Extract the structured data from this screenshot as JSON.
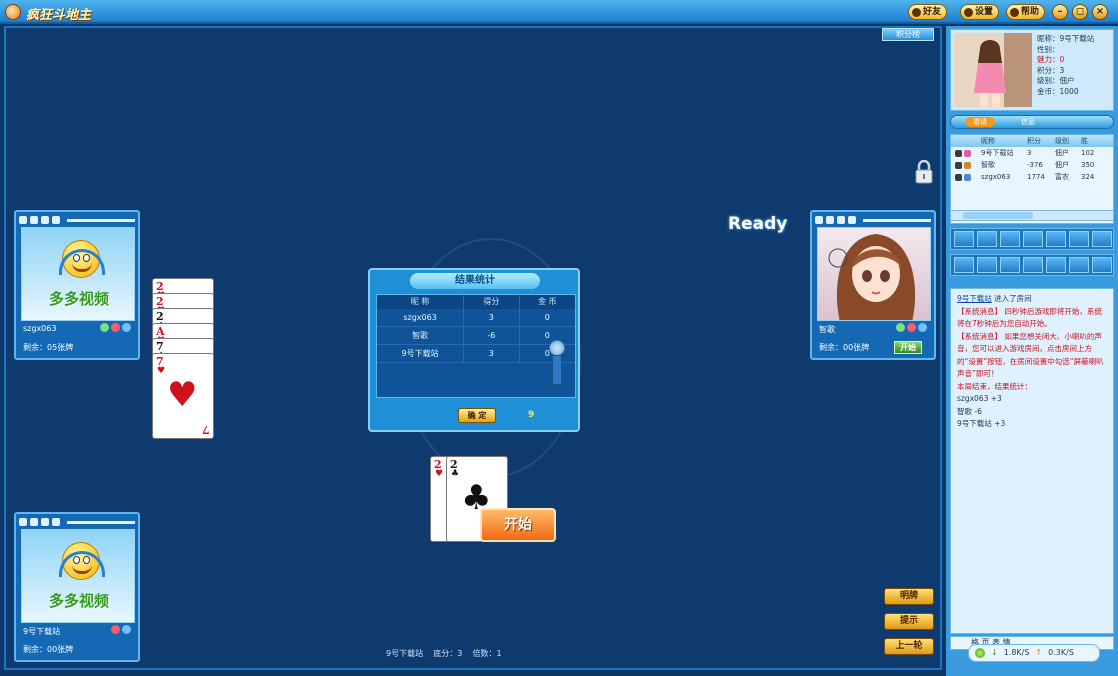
{
  "window": {
    "title": "疯狂斗地主",
    "buttons": [
      "好友",
      "设置",
      "帮助"
    ],
    "controls": [
      "–",
      "◻",
      "×"
    ]
  },
  "game": {
    "top_right_button": "积分榜",
    "ready_text": "Ready",
    "start_button": "开始",
    "side_buttons": [
      "明牌",
      "提示",
      "上一轮"
    ],
    "status": {
      "player": "9号下载站",
      "base": "底分：3",
      "multiplier": "倍数：1"
    }
  },
  "players": {
    "left_top": {
      "name": "szgx063",
      "cards_left": "剩余：05张牌",
      "logo": "多多视频"
    },
    "left_bottom": {
      "name": "9号下载站",
      "cards_left": "剩余：00张牌",
      "logo": "多多视频"
    },
    "right": {
      "name": "智歌",
      "cards_left": "剩余：00张牌",
      "button": "开始"
    }
  },
  "left_cards": [
    {
      "rank": "2",
      "suit": "♥",
      "color": "red"
    },
    {
      "rank": "2",
      "suit": "♥",
      "color": "red"
    },
    {
      "rank": "2",
      "suit": "♠",
      "color": "black"
    },
    {
      "rank": "A",
      "suit": "♥",
      "color": "red"
    },
    {
      "rank": "7",
      "suit": "♠",
      "color": "black"
    },
    {
      "rank": "7",
      "suit": "♥",
      "color": "red"
    }
  ],
  "center_cards": [
    {
      "rank": "2",
      "suit": "♥",
      "color": "red"
    },
    {
      "rank": "2",
      "suit": "♣",
      "color": "black"
    }
  ],
  "settlement": {
    "title": "结果统计",
    "headers": [
      "昵 称",
      "得分",
      "金 币"
    ],
    "rows": [
      {
        "name": "szgx063",
        "score": "3",
        "coins": "0"
      },
      {
        "name": "智歌",
        "score": "-6",
        "coins": "0"
      },
      {
        "name": "9号下载站",
        "score": "3",
        "coins": "0"
      }
    ],
    "ok": "确 定",
    "countdown": "9"
  },
  "profile": {
    "nickname": "昵称：9号下载站",
    "gender": "性别：",
    "charm": "魅力：0",
    "points": "积分：3",
    "level": "级别：佃户",
    "gold": "金币：1000",
    "bar_pill": "邀请",
    "bar_label": "信息"
  },
  "player_list": {
    "headers": [
      "昵称",
      "积分",
      "级别",
      "胜"
    ],
    "rows": [
      {
        "name": "9号下载站",
        "score": "3",
        "level": "佃户",
        "extra": "102"
      },
      {
        "name": "智歌",
        "score": "-376",
        "level": "佃户",
        "extra": "350"
      },
      {
        "name": "szgx063",
        "score": "1774",
        "level": "富农",
        "extra": "324"
      }
    ]
  },
  "chat": [
    {
      "type": "name",
      "text": "9号下载站"
    },
    {
      "type": "norm",
      "text": " 进入了房间"
    },
    {
      "type": "sys",
      "text": "【系统消息】 四秒钟后游戏即将开始，系统将在7秒钟后为您自动开始。"
    },
    {
      "type": "sys",
      "text": "【系统消息】 如果您想关闭大、小喇叭的声音，您可以进入游戏房间，点击房间上方的“设置”按钮，在房间设置中勾选“屏蔽喇叭声音”即可！"
    },
    {
      "type": "sys",
      "text": "本局结束，结果统计："
    },
    {
      "type": "norm",
      "text": "szgx063  +3"
    },
    {
      "type": "norm",
      "text": "智歌  -6"
    },
    {
      "type": "norm",
      "text": "9号下载站  +3"
    }
  ],
  "footer": {
    "down": "1.8K/S",
    "up": "0.3K/S",
    "chat_tools": "格 页 表 情"
  }
}
